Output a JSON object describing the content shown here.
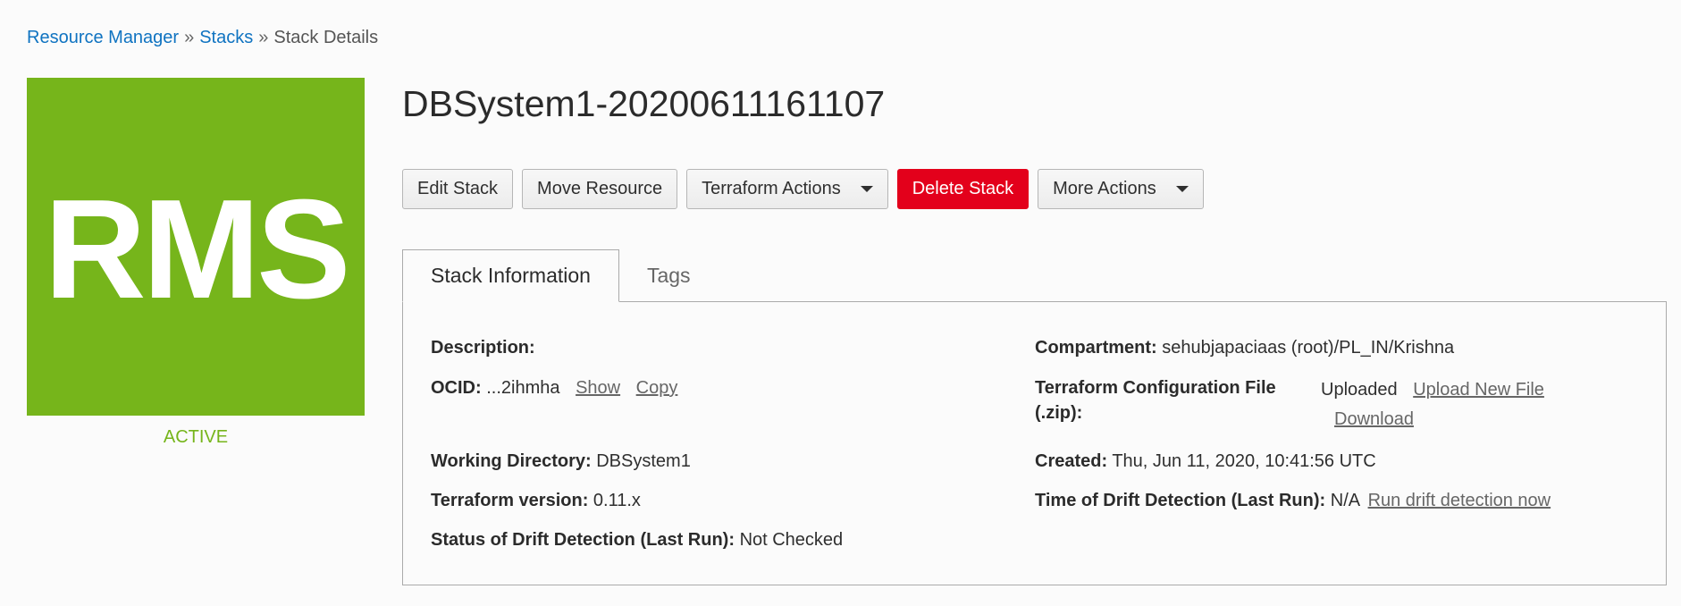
{
  "breadcrumb": {
    "items": [
      "Resource Manager",
      "Stacks"
    ],
    "separator": "»",
    "current": "Stack Details"
  },
  "logo": {
    "text": "RMS",
    "color": "#76b51b"
  },
  "status": {
    "text": "ACTIVE",
    "color": "#76b51b"
  },
  "title": "DBSystem1-20200611161107",
  "actions": {
    "edit": "Edit Stack",
    "move": "Move Resource",
    "terraform": "Terraform Actions",
    "delete": "Delete Stack",
    "more": "More Actions"
  },
  "tabs": [
    {
      "label": "Stack Information",
      "active": true
    },
    {
      "label": "Tags",
      "active": false
    }
  ],
  "info": {
    "description": {
      "label": "Description:",
      "value": ""
    },
    "ocid": {
      "label": "OCID:",
      "value": "...2ihmha",
      "show": "Show",
      "copy": "Copy"
    },
    "working_directory": {
      "label": "Working Directory:",
      "value": "DBSystem1"
    },
    "terraform_version": {
      "label": "Terraform version:",
      "value": "0.11.x"
    },
    "drift_status": {
      "label": "Status of Drift Detection (Last Run):",
      "value": "Not Checked"
    },
    "compartment": {
      "label": "Compartment:",
      "value": "sehubjapaciaas (root)/PL_IN/Krishna"
    },
    "config_file": {
      "label_line1": "Terraform Configuration File",
      "label_line2": "(.zip):",
      "value": "Uploaded",
      "upload_link": "Upload New File",
      "download_link": "Download"
    },
    "created": {
      "label": "Created:",
      "value": "Thu, Jun 11, 2020, 10:41:56 UTC"
    },
    "drift_time": {
      "label": "Time of Drift Detection (Last Run):",
      "value": "N/A",
      "run_link": "Run drift detection now"
    }
  },
  "colors": {
    "link": "#0f73c1",
    "danger": "#e3001b",
    "accent": "#76b51b"
  }
}
